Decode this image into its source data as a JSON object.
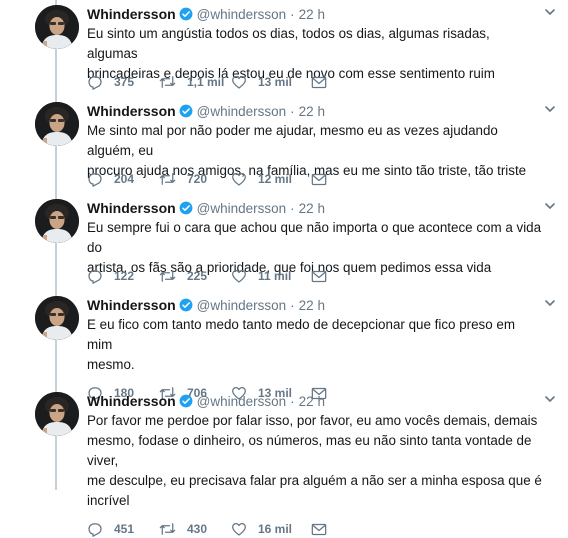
{
  "colors": {
    "text": "#14171a",
    "muted": "#657786",
    "verified": "#1da1f2",
    "line": "#c4cfd6"
  },
  "icons": {
    "verified": "verified-badge-icon",
    "caret": "chevron-down-icon",
    "reply": "reply-icon",
    "retweet": "retweet-icon",
    "like": "heart-icon",
    "dm": "envelope-icon"
  },
  "tweets": [
    {
      "name": "Whindersson",
      "handle": "@whindersson",
      "time": "22 h",
      "lines": [
        "Eu sinto um angústia todos os dias, todos os dias, algumas risadas, algumas",
        "brincadeiras e depois lá estou eu de novo com esse sentimento ruim"
      ],
      "replies": "375",
      "retweets": "1,1 mil",
      "likes": "13 mil"
    },
    {
      "name": "Whindersson",
      "handle": "@whindersson",
      "time": "22 h",
      "lines": [
        "Me sinto mal por não poder me ajudar, mesmo eu as vezes ajudando alguém, eu",
        "procuro ajuda nos amigos, na família, mas eu me sinto tão triste, tão triste"
      ],
      "replies": "204",
      "retweets": "720",
      "likes": "12 mil"
    },
    {
      "name": "Whindersson",
      "handle": "@whindersson",
      "time": "22 h",
      "lines": [
        "Eu sempre fui o cara que achou que não importa o que acontece com a vida do",
        "artista, os fãs são a prioridade, que foi nos quem pedimos essa vida"
      ],
      "replies": "122",
      "retweets": "225",
      "likes": "11 mil"
    },
    {
      "name": "Whindersson",
      "handle": "@whindersson",
      "time": "22 h",
      "lines": [
        "E eu fico com tanto medo tanto medo de decepcionar que fico preso em mim",
        "mesmo."
      ],
      "replies": "180",
      "retweets": "706",
      "likes": "13 mil"
    },
    {
      "name": "Whindersson",
      "handle": "@whindersson",
      "time": "22 h",
      "lines": [
        "Por favor me perdoe por falar isso, por favor, eu amo vocês demais, demais",
        "mesmo, fodase o dinheiro, os números, mas eu não sinto tanta vontade de viver,",
        "me desculpe, eu precisava falar pra alguém a não ser a minha esposa que é",
        "incrível"
      ],
      "replies": "451",
      "retweets": "430",
      "likes": "16 mil"
    }
  ]
}
